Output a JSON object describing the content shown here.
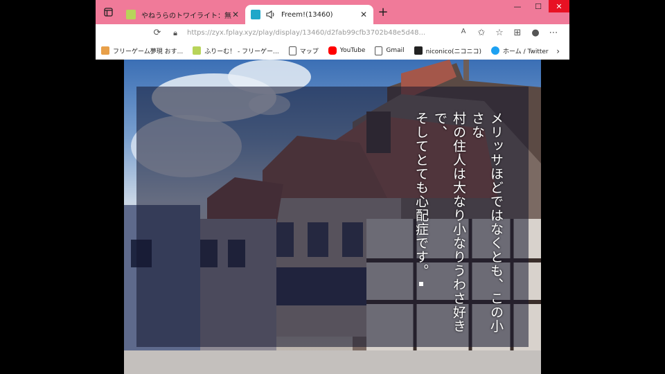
{
  "browser": {
    "tabs": [
      {
        "title": "やねうらのトワイライト：無料ゲーム配",
        "active": false,
        "favicon_color": "#b8d45a"
      },
      {
        "title": "Freem!(13460)",
        "active": true,
        "favicon_color": "#1fa7c9"
      }
    ],
    "url": "https://zyx.fplay.xyz/play/display/13460/d2fab99cfb3702b48e5d48...",
    "bookmarks": [
      {
        "label": "フリーゲーム夢現 おす...",
        "color": "#e8a04a",
        "icon": "face-icon"
      },
      {
        "label": "ふりーむ！ - フリーゲー...",
        "color": "#b8d45a",
        "icon": "freem-icon"
      },
      {
        "label": "マップ",
        "color": "#ffffff",
        "icon": "page-icon"
      },
      {
        "label": "YouTube",
        "color": "#ff0000",
        "icon": "youtube-icon"
      },
      {
        "label": "Gmail",
        "color": "#ffffff",
        "icon": "page-icon"
      },
      {
        "label": "niconico(ニコニコ)",
        "color": "#222222",
        "icon": "niconico-icon"
      },
      {
        "label": "ホーム / Twitter",
        "color": "#1da1f2",
        "icon": "twitter-icon"
      }
    ]
  },
  "game": {
    "dialogue": [
      "メリッサほどではなくとも、この小さな",
      "村の住人は大なり小なりうわさ好きで、",
      "そしてとても心配症です。"
    ]
  }
}
